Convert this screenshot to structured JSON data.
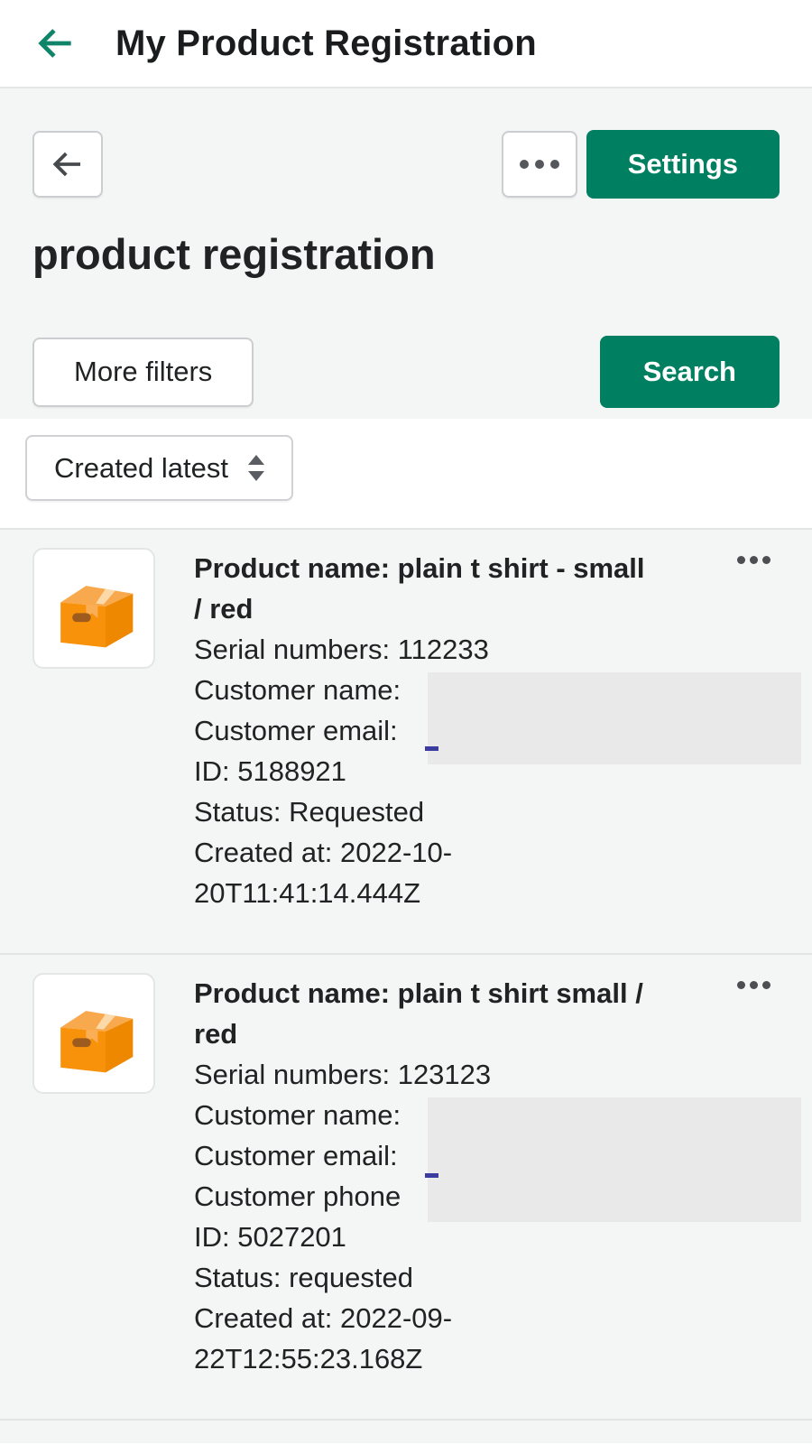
{
  "app_bar": {
    "title": "My Product Registration"
  },
  "toolbar": {
    "settings_label": "Settings"
  },
  "page": {
    "title": "product registration"
  },
  "filters": {
    "more_filters_label": "More filters",
    "search_label": "Search"
  },
  "sort": {
    "selected": "Created latest"
  },
  "icons": {
    "app_back": "arrow-left",
    "page_back": "arrow-left",
    "more_actions": "horizontal-dots",
    "sort": "up-down-arrows",
    "item_menu": "horizontal-dots",
    "thumbnail": "package-box"
  },
  "colors": {
    "primary": "#008060",
    "appbar_accent": "#0f8468",
    "text": "#202223",
    "surface_subdued": "#f4f5f5",
    "redaction": "#e9e9e9",
    "divider": "#e2e4e6",
    "link": "#3b3ba0"
  },
  "items": [
    {
      "title_lines": [
        "Product name: plain t shirt - small",
        "/ red"
      ],
      "detail_lines": [
        "Serial numbers: 112233",
        "Customer name:",
        "Customer email:",
        "ID: 5188921",
        "Status: Requested",
        "Created at: 2022-10-",
        "20T11:41:14.444Z"
      ]
    },
    {
      "title_lines": [
        "Product name: plain t shirt small /",
        "red"
      ],
      "detail_lines": [
        "Serial numbers: 123123",
        "Customer name:",
        "Customer email:",
        "Customer phone",
        "ID: 5027201",
        "Status: requested",
        "Created at: 2022-09-",
        "22T12:55:23.168Z"
      ]
    }
  ]
}
